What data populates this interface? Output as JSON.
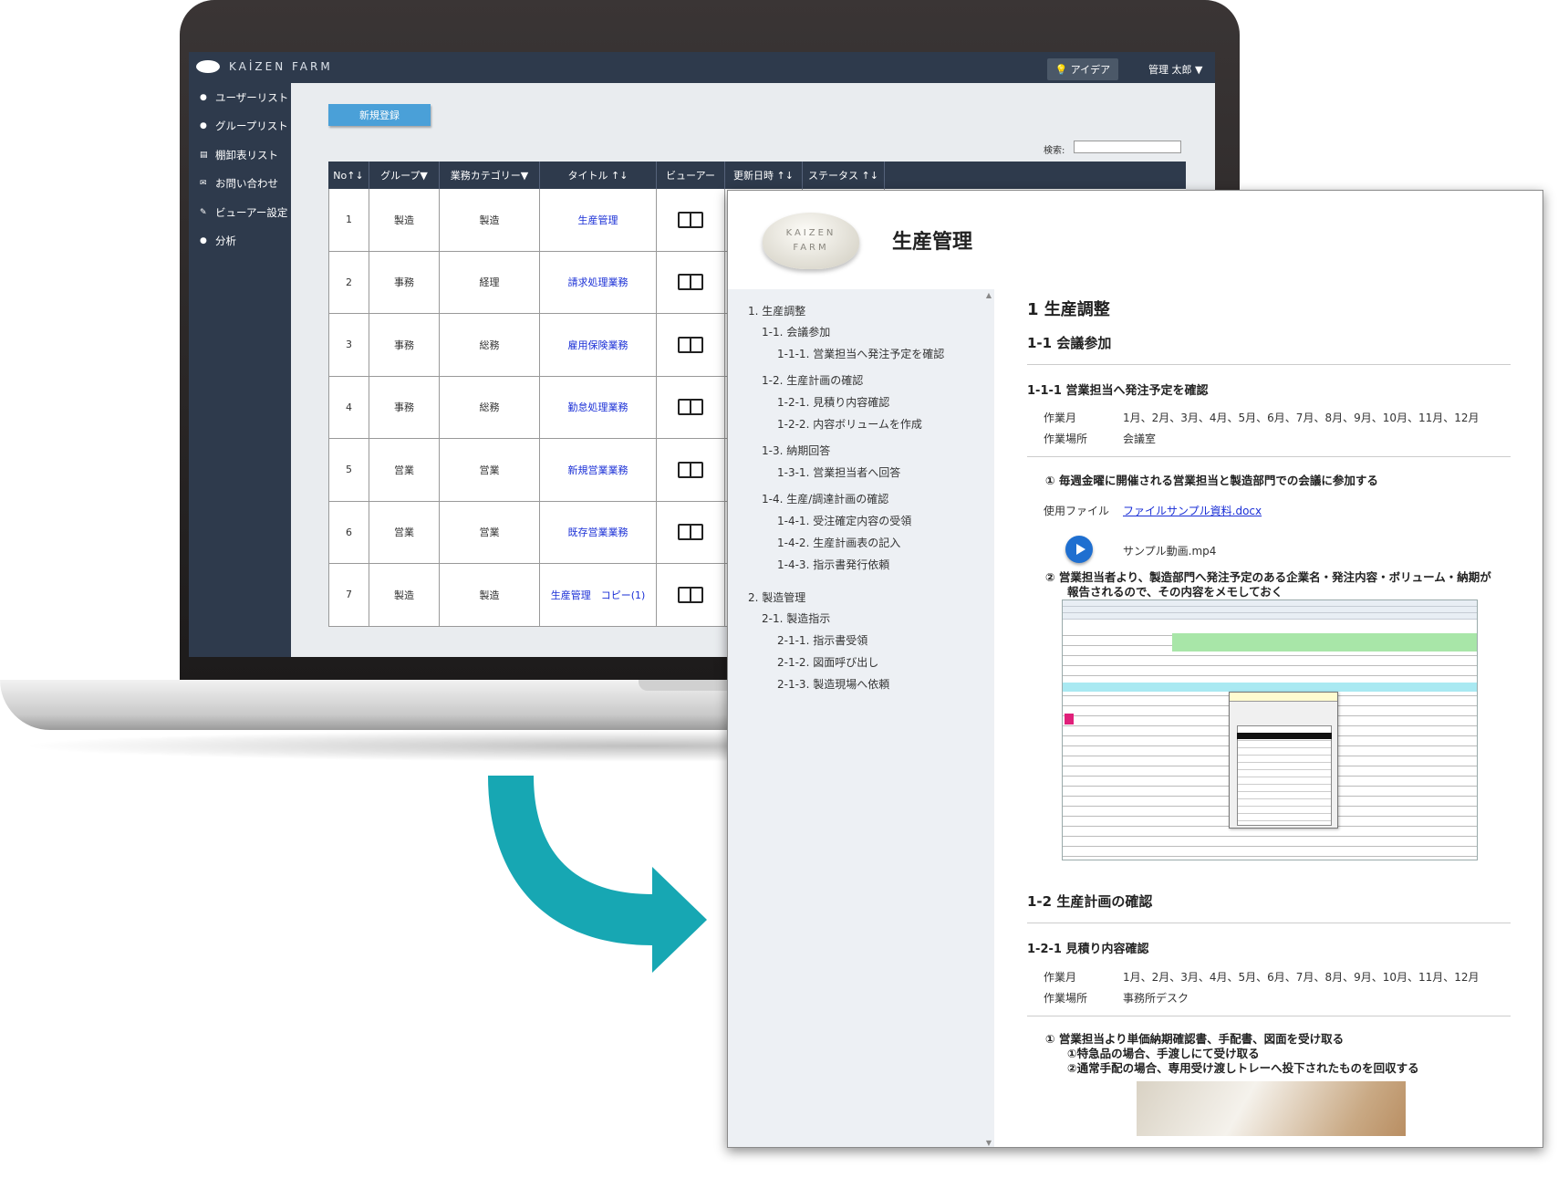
{
  "app": {
    "brand": "KAİZEN FARM",
    "idea_button": "アイデア",
    "user_menu": "管理 太郎 ▼"
  },
  "sidebar": {
    "items": [
      {
        "label": "ユーザーリスト",
        "icon": "user-icon"
      },
      {
        "label": "グループリスト",
        "icon": "group-icon"
      },
      {
        "label": "棚卸表リスト",
        "icon": "list-icon"
      },
      {
        "label": "お問い合わせ",
        "icon": "mail-icon"
      },
      {
        "label": "ビューアー設定",
        "icon": "edit-icon"
      },
      {
        "label": "分析",
        "icon": "chart-icon"
      }
    ]
  },
  "list": {
    "new_button": "新規登録",
    "search_label": "検索:",
    "search_value": "",
    "columns": [
      "No↑↓",
      "グループ▼",
      "業務カテゴリー▼",
      "タイトル ↑↓",
      "ビューアー",
      "更新日時 ↑↓",
      "ステータス ↑↓"
    ],
    "rows": [
      {
        "no": "1",
        "group": "製造",
        "category": "製造",
        "title": "生産管理"
      },
      {
        "no": "2",
        "group": "事務",
        "category": "経理",
        "title": "請求処理業務"
      },
      {
        "no": "3",
        "group": "事務",
        "category": "総務",
        "title": "雇用保険業務"
      },
      {
        "no": "4",
        "group": "事務",
        "category": "総務",
        "title": "勤怠処理業務"
      },
      {
        "no": "5",
        "group": "営業",
        "category": "営業",
        "title": "新規営業業務"
      },
      {
        "no": "6",
        "group": "営業",
        "category": "営業",
        "title": "既存営業業務"
      },
      {
        "no": "7",
        "group": "製造",
        "category": "製造",
        "title": "生産管理　コピー(1)"
      }
    ]
  },
  "viewer": {
    "logo_line1": "KAIZEN",
    "logo_line2": "FARM",
    "title": "生産管理",
    "toc": [
      {
        "level": 1,
        "label": "1. 生産調整"
      },
      {
        "level": 2,
        "label": "1-1. 会議参加"
      },
      {
        "level": 3,
        "label": "1-1-1. 営業担当へ発注予定を確認"
      },
      {
        "level": 2,
        "label": "1-2. 生産計画の確認"
      },
      {
        "level": 3,
        "label": "1-2-1. 見積り内容確認"
      },
      {
        "level": 3,
        "label": "1-2-2. 内容ボリュームを作成"
      },
      {
        "level": 2,
        "label": "1-3. 納期回答"
      },
      {
        "level": 3,
        "label": "1-3-1. 営業担当者へ回答"
      },
      {
        "level": 2,
        "label": "1-4. 生産/調達計画の確認"
      },
      {
        "level": 3,
        "label": "1-4-1. 受注確定内容の受領"
      },
      {
        "level": 3,
        "label": "1-4-2. 生産計画表の記入"
      },
      {
        "level": 3,
        "label": "1-4-3. 指示書発行依頼"
      },
      {
        "level": 1,
        "label": "2. 製造管理"
      },
      {
        "level": 2,
        "label": "2-1. 製造指示"
      },
      {
        "level": 3,
        "label": "2-1-1. 指示書受領"
      },
      {
        "level": 3,
        "label": "2-1-2. 図面呼び出し"
      },
      {
        "level": 3,
        "label": "2-1-3. 製造現場へ依頼"
      }
    ],
    "content": {
      "h1": "1 生産調整",
      "s1_h2": "1-1 会議参加",
      "s1_h3": "1-1-1 営業担当へ発注予定を確認",
      "s1_k1": "作業月",
      "s1_v1": "1月、2月、3月、4月、5月、6月、7月、8月、9月、10月、11月、12月",
      "s1_k2": "作業場所",
      "s1_v2": "会議室",
      "s1_step1": "① 毎週金曜に開催される営業担当と製造部門での会議に参加する",
      "file_label": "使用ファイル",
      "file_link": "ファイルサンプル資料.docx",
      "video_label": "サンプル動画.mp4",
      "s1_step2_line1": "② 営業担当者より、製造部門へ発注予定のある企業名・発注内容・ボリューム・納期が",
      "s1_step2_line2": "報告されるので、その内容をメモしておく",
      "s2_h2": "1-2 生産計画の確認",
      "s2_h3": "1-2-1 見積り内容確認",
      "s2_k1": "作業月",
      "s2_v1": "1月、2月、3月、4月、5月、6月、7月、8月、9月、10月、11月、12月",
      "s2_k2": "作業場所",
      "s2_v2": "事務所デスク",
      "s2_step1_line1": "① 営業担当より単価納期確認書、手配書、図面を受け取る",
      "s2_step1_line2": "①特急品の場合、手渡しにて受け取る",
      "s2_step1_line3": "②通常手配の場合、専用受け渡しトレーへ投下されたものを回収する"
    }
  },
  "colors": {
    "nav_dark": "#2e3a4c",
    "accent_blue": "#4aa0d8",
    "link_blue": "#1a2fd6",
    "arrow_teal": "#17a7b3"
  }
}
